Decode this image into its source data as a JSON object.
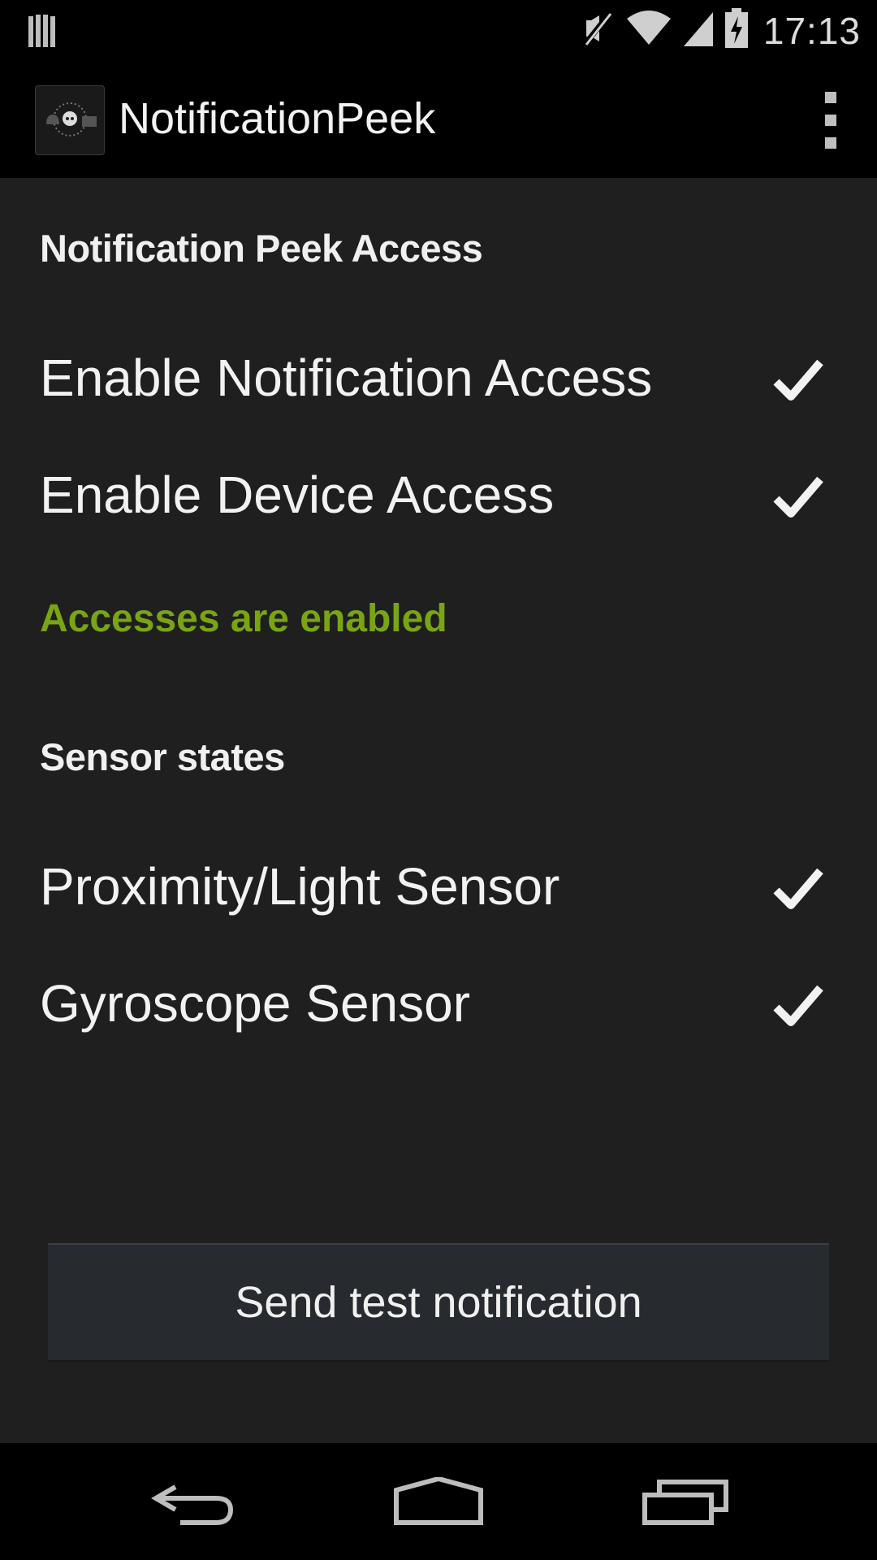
{
  "status_bar": {
    "time": "17:13",
    "icons": [
      "notification-icon",
      "mute-icon",
      "wifi-icon",
      "signal-icon",
      "battery-charging-icon"
    ]
  },
  "action_bar": {
    "title": "NotificationPeek",
    "icons": [
      "app-icon",
      "overflow-menu-icon"
    ]
  },
  "access_section": {
    "header": "Notification Peek Access",
    "items": [
      {
        "label": "Enable Notification Access",
        "checked": true
      },
      {
        "label": "Enable Device Access",
        "checked": true
      }
    ],
    "status": "Accesses are enabled",
    "status_color": "#79a514"
  },
  "sensor_section": {
    "header": "Sensor states",
    "items": [
      {
        "label": "Proximity/Light Sensor",
        "checked": true
      },
      {
        "label": "Gyroscope Sensor",
        "checked": true
      }
    ]
  },
  "send_button": {
    "label": "Send test notification"
  },
  "nav_bar": {
    "icons": [
      "back-icon",
      "home-icon",
      "recents-icon"
    ]
  }
}
